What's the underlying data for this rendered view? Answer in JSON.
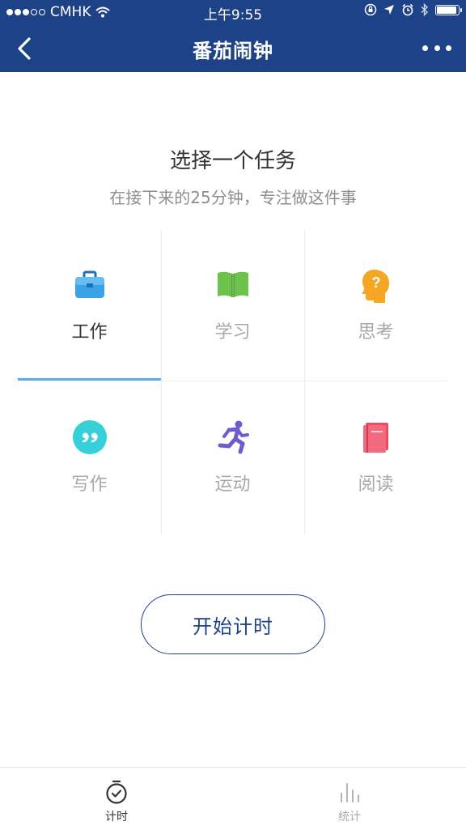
{
  "status_bar": {
    "carrier": "CMHK",
    "time": "上午9:55"
  },
  "nav": {
    "title": "番茄闹钟",
    "back_icon": "chevron-left-icon",
    "more_icon": "more-dots-icon"
  },
  "main": {
    "heading": "选择一个任务",
    "subheading": "在接下来的25分钟，专注做这件事",
    "tasks": [
      {
        "label": "工作",
        "icon": "briefcase-icon",
        "color": "#3aa3e8",
        "selected": true
      },
      {
        "label": "学习",
        "icon": "open-book-icon",
        "color": "#6cc24a",
        "selected": false
      },
      {
        "label": "思考",
        "icon": "thinking-head-icon",
        "color": "#f5a623",
        "selected": false
      },
      {
        "label": "写作",
        "icon": "quote-icon",
        "color": "#35d0d8",
        "selected": false
      },
      {
        "label": "运动",
        "icon": "running-person-icon",
        "color": "#6e5ccf",
        "selected": false
      },
      {
        "label": "阅读",
        "icon": "book-icon",
        "color": "#f04a63",
        "selected": false
      }
    ],
    "start_label": "开始计时"
  },
  "tabbar": {
    "items": [
      {
        "label": "计时",
        "icon": "stopwatch-icon",
        "active": true
      },
      {
        "label": "统计",
        "icon": "bar-chart-icon",
        "active": false
      }
    ]
  },
  "colors": {
    "brand": "#1e4287",
    "accent": "#5aaaf0",
    "active_label": "#333333",
    "inactive_label": "#a8a8a8"
  }
}
